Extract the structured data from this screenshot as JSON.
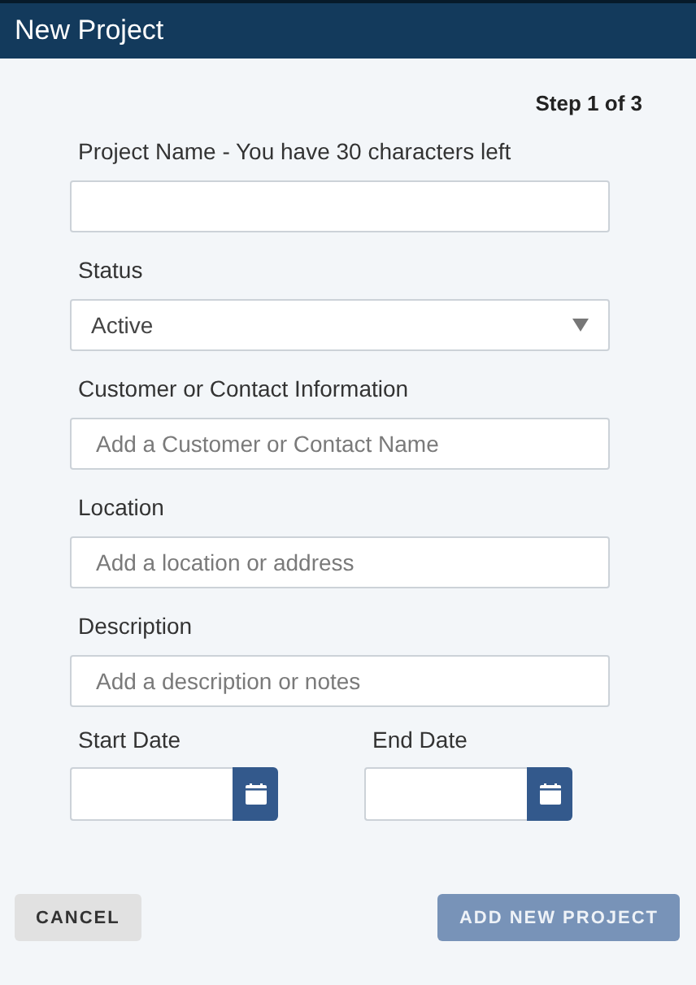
{
  "window": {
    "title": "New Project"
  },
  "step": "Step 1 of 3",
  "fields": [
    {
      "kind": "text",
      "label": "Project Name - You have 30 characters left"
    },
    {
      "kind": "select",
      "label": "Status",
      "value": "Active"
    },
    {
      "kind": "text",
      "label": "Customer or Contact Information",
      "placeholder": "Add a Customer or Contact Name"
    },
    {
      "kind": "text",
      "label": "Location",
      "placeholder": "Add a location or address"
    },
    {
      "kind": "text",
      "label": "Description",
      "placeholder": "Add a description or notes"
    }
  ],
  "dates": [
    {
      "label": "Start Date"
    },
    {
      "label": "End Date"
    }
  ],
  "buttons": [
    {
      "kind": "secondary",
      "label": "CANCEL",
      "disabled": false
    },
    {
      "kind": "primary",
      "label": "ADD NEW PROJECT",
      "disabled": true
    }
  ]
}
